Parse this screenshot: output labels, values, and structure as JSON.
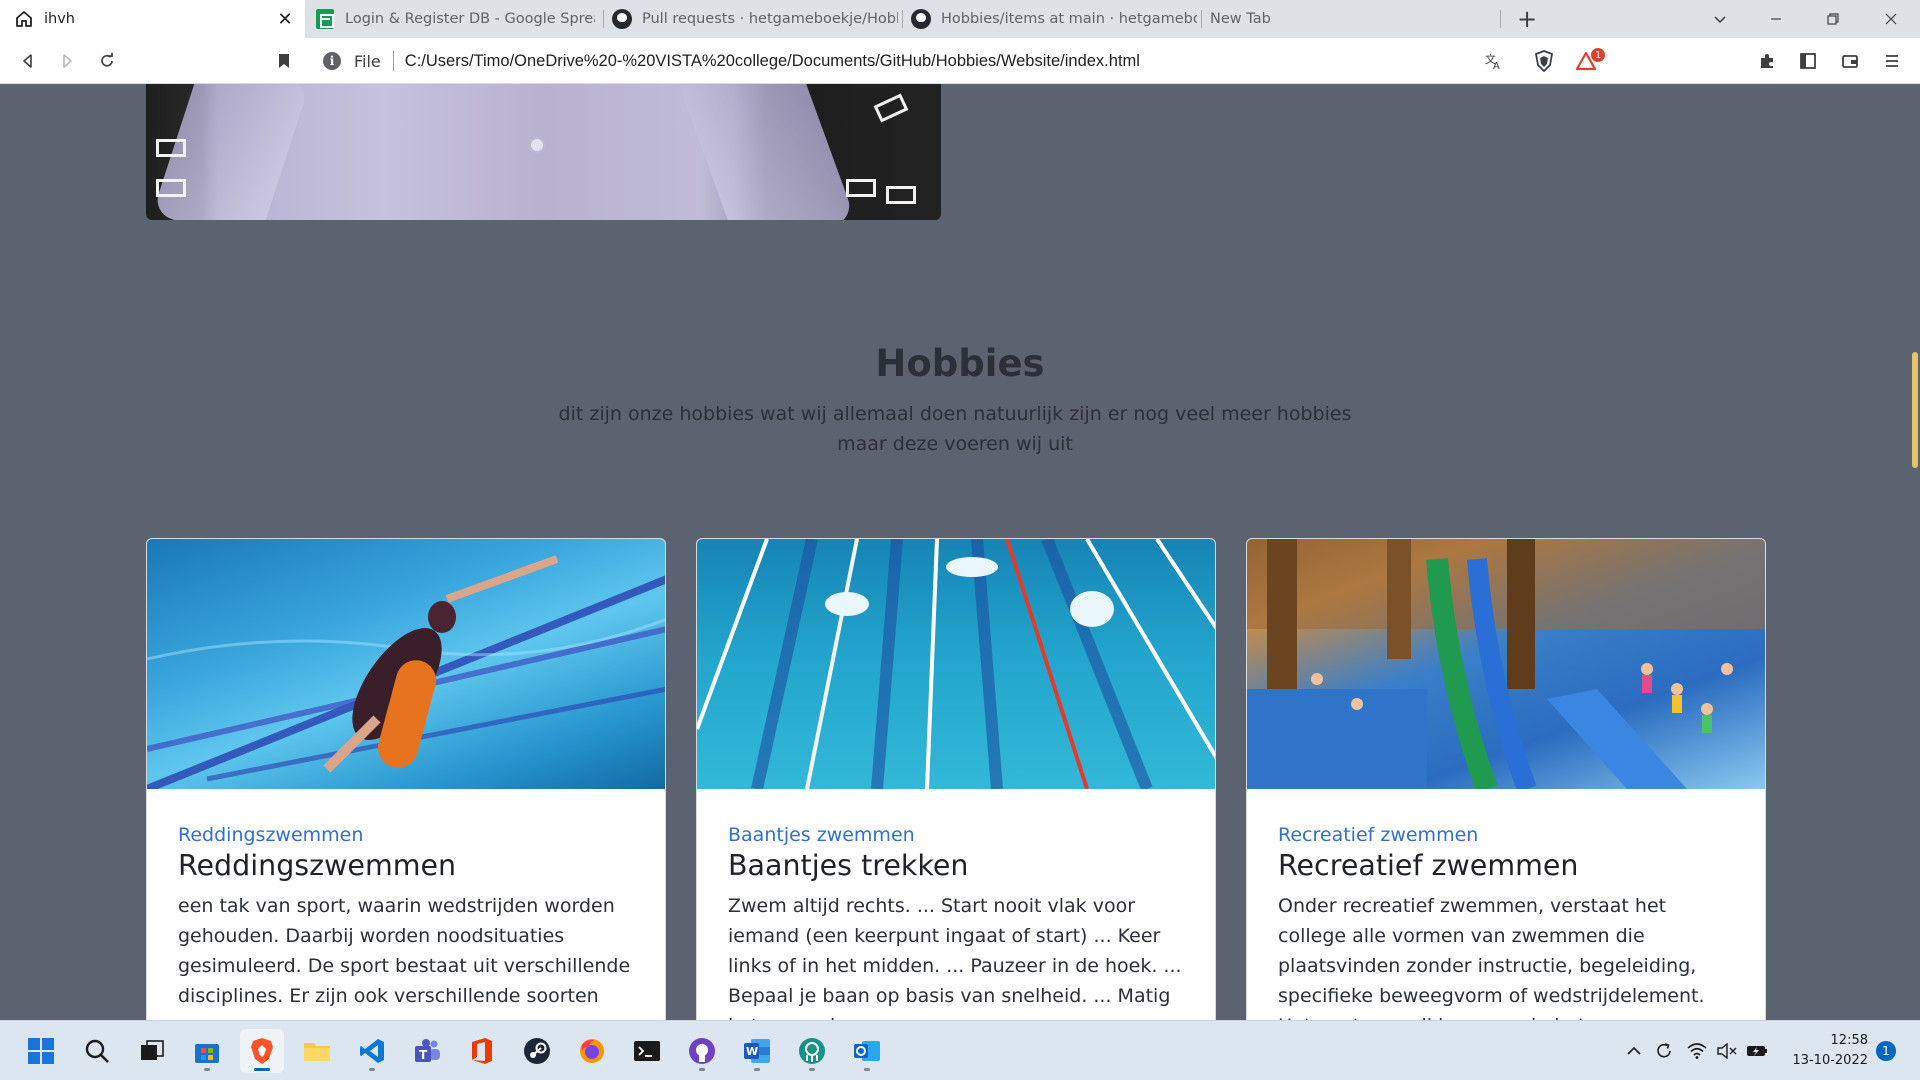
{
  "browser": {
    "tabs": [
      {
        "title": "ihvh",
        "icon": "home-icon",
        "active": true
      },
      {
        "title": "Login & Register DB - Google Spreads",
        "icon": "google-sheets-icon"
      },
      {
        "title": "Pull requests · hetgameboekje/Hobbie",
        "icon": "github-icon"
      },
      {
        "title": "Hobbies/items at main · hetgameboek",
        "icon": "github-icon"
      },
      {
        "title": "New Tab",
        "icon": ""
      }
    ],
    "address": {
      "scheme_label": "File",
      "url": "C:/Users/Timo/OneDrive%20-%20VISTA%20college/Documents/GitHub/Hobbies/Website/index.html"
    },
    "brave_rewards_badge": "1"
  },
  "page": {
    "section": {
      "title": "Hobbies",
      "subtitle": "dit zijn onze hobbies wat wij allemaal doen natuurlijk zijn er nog veel meer hobbies maar deze voeren wij uit"
    },
    "cards": [
      {
        "kicker": "Reddingszwemmen",
        "title": "Reddingszwemmen",
        "text": "een tak van sport, waarin wedstrijden worden gehouden. Daarbij worden noodsituaties gesimuleerd. De sport bestaat uit verschillende disciplines. Er zijn ook verschillende soorten"
      },
      {
        "kicker": "Baantjes zwemmen",
        "title": "Baantjes trekken",
        "text": "Zwem altijd rechts. ... Start nooit vlak voor iemand (een keerpunt ingaat of start) ... Keer links of in het midden. ... Pauzeer in de hoek. ... Bepaal je baan op basis van snelheid. ... Matig je tempo als"
      },
      {
        "kicker": "Recreatief zwemmen",
        "title": "Recreatief zwemmen",
        "text": "Onder recreatief zwemmen, verstaat het college alle vormen van zwemmen die plaatsvinden zonder instructie, begeleiding, specifieke beweegvorm of wedstrijdelement. Het gaat om vrij bewegen in het"
      }
    ]
  },
  "taskbar": {
    "apps": [
      "windows-start-icon",
      "search-icon",
      "task-view-icon",
      "microsoft-store-icon",
      "brave-icon",
      "file-explorer-icon",
      "vscode-icon",
      "teams-icon",
      "office-icon",
      "steam-icon",
      "firefox-icon",
      "terminal-icon",
      "github-desktop-icon",
      "word-icon",
      "gitkraken-icon",
      "outlook-icon"
    ],
    "clock_time": "12:58",
    "clock_date": "13-10-2022",
    "notifications": "1"
  },
  "colors": {
    "page_bg": "#5c6370",
    "link_blue": "#2e6fd6",
    "card_bg": "#ffffff"
  }
}
